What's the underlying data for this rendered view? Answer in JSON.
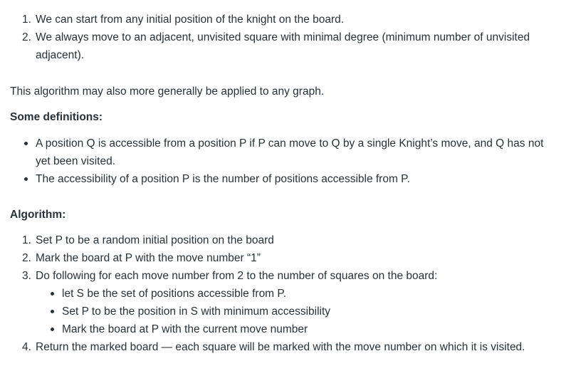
{
  "intro_list": [
    {
      "num": "1.",
      "text": "We can start from any initial position of the knight on the board."
    },
    {
      "num": "2.",
      "text": "We always move to an adjacent, unvisited square with minimal degree (minimum number of unvisited adjacent)."
    }
  ],
  "general_note": "This algorithm may also more generally be applied to any graph.",
  "definitions_heading": "Some definitions:",
  "definitions": [
    "A position Q is accessible from a position P if P can move to Q by a single Knight’s move, and Q has not yet been visited.",
    "The accessibility of a position P is the number of positions accessible from P."
  ],
  "algorithm_heading": "Algorithm:",
  "algorithm_steps": [
    {
      "num": "1.",
      "text": "Set P to be a random initial position on the board"
    },
    {
      "num": "2.",
      "text": "Mark the board at P with the move number “1”"
    },
    {
      "num": "3.",
      "text": "Do following for each move number from 2 to the number of squares on the board:"
    },
    {
      "num": "4.",
      "text": "Return the marked board — each square will be marked with the move number on which it is visited."
    }
  ],
  "algorithm_substeps": [
    "let S be the set of positions accessible from P.",
    "Set P to be the position in S with minimum accessibility",
    "Mark the board at P with the current move number"
  ]
}
